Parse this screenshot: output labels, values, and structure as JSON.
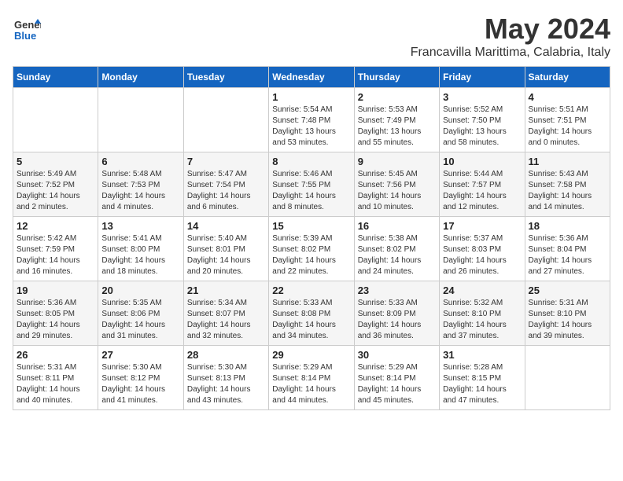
{
  "logo": {
    "general": "General",
    "blue": "Blue"
  },
  "title": "May 2024",
  "subtitle": "Francavilla Marittima, Calabria, Italy",
  "weekdays": [
    "Sunday",
    "Monday",
    "Tuesday",
    "Wednesday",
    "Thursday",
    "Friday",
    "Saturday"
  ],
  "weeks": [
    [
      {
        "day": "",
        "sunrise": "",
        "sunset": "",
        "daylight": ""
      },
      {
        "day": "",
        "sunrise": "",
        "sunset": "",
        "daylight": ""
      },
      {
        "day": "",
        "sunrise": "",
        "sunset": "",
        "daylight": ""
      },
      {
        "day": "1",
        "sunrise": "Sunrise: 5:54 AM",
        "sunset": "Sunset: 7:48 PM",
        "daylight": "Daylight: 13 hours and 53 minutes."
      },
      {
        "day": "2",
        "sunrise": "Sunrise: 5:53 AM",
        "sunset": "Sunset: 7:49 PM",
        "daylight": "Daylight: 13 hours and 55 minutes."
      },
      {
        "day": "3",
        "sunrise": "Sunrise: 5:52 AM",
        "sunset": "Sunset: 7:50 PM",
        "daylight": "Daylight: 13 hours and 58 minutes."
      },
      {
        "day": "4",
        "sunrise": "Sunrise: 5:51 AM",
        "sunset": "Sunset: 7:51 PM",
        "daylight": "Daylight: 14 hours and 0 minutes."
      }
    ],
    [
      {
        "day": "5",
        "sunrise": "Sunrise: 5:49 AM",
        "sunset": "Sunset: 7:52 PM",
        "daylight": "Daylight: 14 hours and 2 minutes."
      },
      {
        "day": "6",
        "sunrise": "Sunrise: 5:48 AM",
        "sunset": "Sunset: 7:53 PM",
        "daylight": "Daylight: 14 hours and 4 minutes."
      },
      {
        "day": "7",
        "sunrise": "Sunrise: 5:47 AM",
        "sunset": "Sunset: 7:54 PM",
        "daylight": "Daylight: 14 hours and 6 minutes."
      },
      {
        "day": "8",
        "sunrise": "Sunrise: 5:46 AM",
        "sunset": "Sunset: 7:55 PM",
        "daylight": "Daylight: 14 hours and 8 minutes."
      },
      {
        "day": "9",
        "sunrise": "Sunrise: 5:45 AM",
        "sunset": "Sunset: 7:56 PM",
        "daylight": "Daylight: 14 hours and 10 minutes."
      },
      {
        "day": "10",
        "sunrise": "Sunrise: 5:44 AM",
        "sunset": "Sunset: 7:57 PM",
        "daylight": "Daylight: 14 hours and 12 minutes."
      },
      {
        "day": "11",
        "sunrise": "Sunrise: 5:43 AM",
        "sunset": "Sunset: 7:58 PM",
        "daylight": "Daylight: 14 hours and 14 minutes."
      }
    ],
    [
      {
        "day": "12",
        "sunrise": "Sunrise: 5:42 AM",
        "sunset": "Sunset: 7:59 PM",
        "daylight": "Daylight: 14 hours and 16 minutes."
      },
      {
        "day": "13",
        "sunrise": "Sunrise: 5:41 AM",
        "sunset": "Sunset: 8:00 PM",
        "daylight": "Daylight: 14 hours and 18 minutes."
      },
      {
        "day": "14",
        "sunrise": "Sunrise: 5:40 AM",
        "sunset": "Sunset: 8:01 PM",
        "daylight": "Daylight: 14 hours and 20 minutes."
      },
      {
        "day": "15",
        "sunrise": "Sunrise: 5:39 AM",
        "sunset": "Sunset: 8:02 PM",
        "daylight": "Daylight: 14 hours and 22 minutes."
      },
      {
        "day": "16",
        "sunrise": "Sunrise: 5:38 AM",
        "sunset": "Sunset: 8:02 PM",
        "daylight": "Daylight: 14 hours and 24 minutes."
      },
      {
        "day": "17",
        "sunrise": "Sunrise: 5:37 AM",
        "sunset": "Sunset: 8:03 PM",
        "daylight": "Daylight: 14 hours and 26 minutes."
      },
      {
        "day": "18",
        "sunrise": "Sunrise: 5:36 AM",
        "sunset": "Sunset: 8:04 PM",
        "daylight": "Daylight: 14 hours and 27 minutes."
      }
    ],
    [
      {
        "day": "19",
        "sunrise": "Sunrise: 5:36 AM",
        "sunset": "Sunset: 8:05 PM",
        "daylight": "Daylight: 14 hours and 29 minutes."
      },
      {
        "day": "20",
        "sunrise": "Sunrise: 5:35 AM",
        "sunset": "Sunset: 8:06 PM",
        "daylight": "Daylight: 14 hours and 31 minutes."
      },
      {
        "day": "21",
        "sunrise": "Sunrise: 5:34 AM",
        "sunset": "Sunset: 8:07 PM",
        "daylight": "Daylight: 14 hours and 32 minutes."
      },
      {
        "day": "22",
        "sunrise": "Sunrise: 5:33 AM",
        "sunset": "Sunset: 8:08 PM",
        "daylight": "Daylight: 14 hours and 34 minutes."
      },
      {
        "day": "23",
        "sunrise": "Sunrise: 5:33 AM",
        "sunset": "Sunset: 8:09 PM",
        "daylight": "Daylight: 14 hours and 36 minutes."
      },
      {
        "day": "24",
        "sunrise": "Sunrise: 5:32 AM",
        "sunset": "Sunset: 8:10 PM",
        "daylight": "Daylight: 14 hours and 37 minutes."
      },
      {
        "day": "25",
        "sunrise": "Sunrise: 5:31 AM",
        "sunset": "Sunset: 8:10 PM",
        "daylight": "Daylight: 14 hours and 39 minutes."
      }
    ],
    [
      {
        "day": "26",
        "sunrise": "Sunrise: 5:31 AM",
        "sunset": "Sunset: 8:11 PM",
        "daylight": "Daylight: 14 hours and 40 minutes."
      },
      {
        "day": "27",
        "sunrise": "Sunrise: 5:30 AM",
        "sunset": "Sunset: 8:12 PM",
        "daylight": "Daylight: 14 hours and 41 minutes."
      },
      {
        "day": "28",
        "sunrise": "Sunrise: 5:30 AM",
        "sunset": "Sunset: 8:13 PM",
        "daylight": "Daylight: 14 hours and 43 minutes."
      },
      {
        "day": "29",
        "sunrise": "Sunrise: 5:29 AM",
        "sunset": "Sunset: 8:14 PM",
        "daylight": "Daylight: 14 hours and 44 minutes."
      },
      {
        "day": "30",
        "sunrise": "Sunrise: 5:29 AM",
        "sunset": "Sunset: 8:14 PM",
        "daylight": "Daylight: 14 hours and 45 minutes."
      },
      {
        "day": "31",
        "sunrise": "Sunrise: 5:28 AM",
        "sunset": "Sunset: 8:15 PM",
        "daylight": "Daylight: 14 hours and 47 minutes."
      },
      {
        "day": "",
        "sunrise": "",
        "sunset": "",
        "daylight": ""
      }
    ]
  ]
}
